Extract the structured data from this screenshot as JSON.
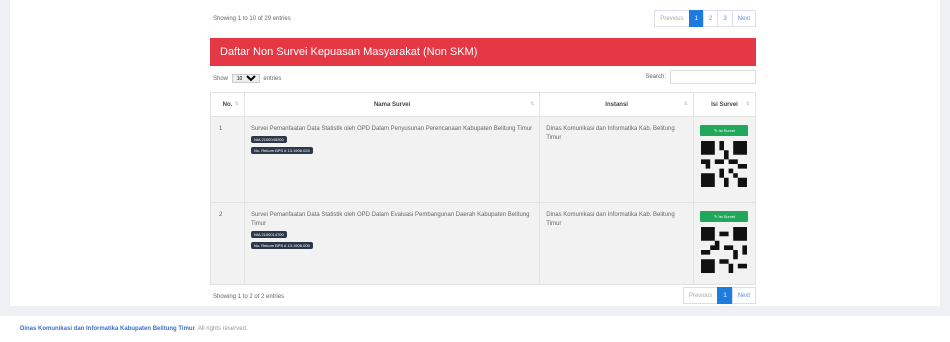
{
  "top": {
    "showing": "Showing 1 to 10 of 29 entries",
    "pager": [
      "Previous",
      "1",
      "2",
      "3",
      "Next"
    ]
  },
  "panel": {
    "title": "Daftar Non Survei Kepuasan Masyarakat (Non SKM)"
  },
  "controls": {
    "show": "Show",
    "entries_value": "10",
    "entries": "entries",
    "search": "Search:"
  },
  "table": {
    "headers": [
      "No.",
      "Nama Survei",
      "Instansi",
      "Isi Survei"
    ],
    "rows": [
      {
        "no": "1",
        "nama": "Survei Pemanfaatan Data Statistik oleh OPD Dalam Penyusunan Perencanaan Kabupaten Belitung Timur",
        "badge1": "NIA 2100045200",
        "badge2": "No. Rekom BPS # 13.1906.024",
        "instansi": "Dinas Komunikasi dan Informatika Kab. Belitung Timur",
        "button": "Isi Survei"
      },
      {
        "no": "2",
        "nama": "Survei Pemanfaatan Data Statistik oleh OPD Dalam Evaluasi Pembangunan Daerah Kabupaten Belitung Timur",
        "badge1": "NIA 2100014700",
        "badge2": "No. Rekom BPS # 13.1906.009",
        "instansi": "Dinas Komunikasi dan Informatika Kab. Belitung Timur",
        "button": "Isi Survei"
      }
    ]
  },
  "bottom": {
    "showing": "Showing 1 to 2 of 2 entries",
    "pager": [
      "Previous",
      "1",
      "Next"
    ]
  },
  "footer": {
    "org": "Dinas Komunikasi dan Informatika Kabupaten Belitung Timur",
    "rights": ". All rights reserved."
  }
}
